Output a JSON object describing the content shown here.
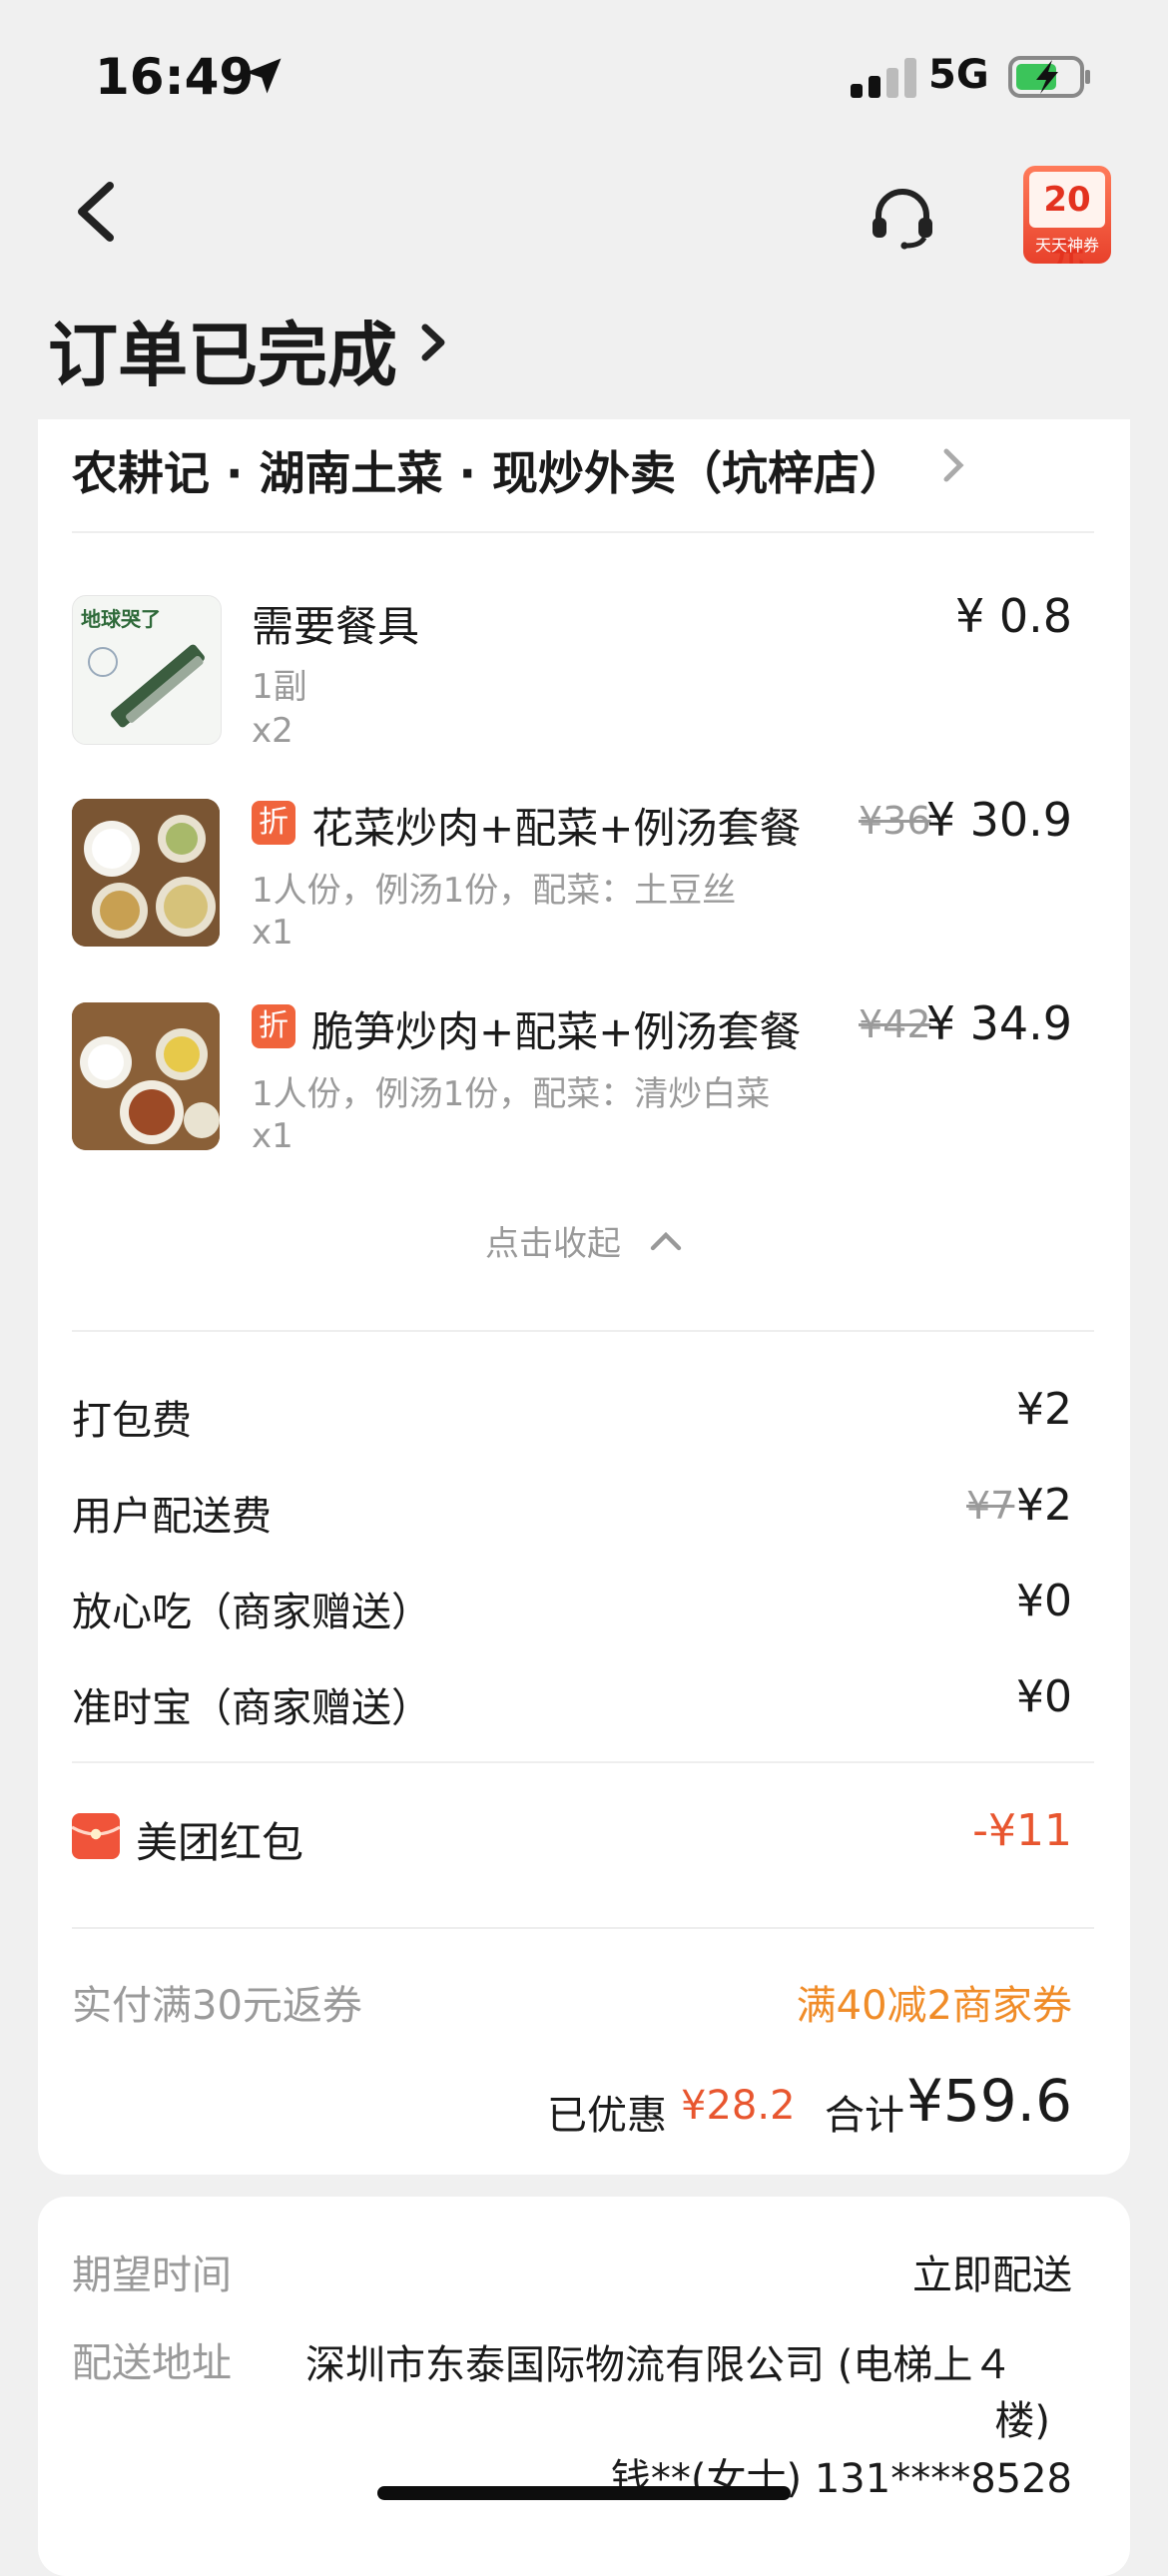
{
  "status_bar": {
    "time": "16:49",
    "network": "5G"
  },
  "header": {
    "promo_amount": "20元",
    "promo_sub": "天天神券",
    "title": "订单已完成"
  },
  "store": {
    "name": "农耕记 · 湖南土菜 · 现炒外卖（坑梓店）"
  },
  "items": [
    {
      "name": "需要餐具",
      "spec": "1副",
      "qty": "x2",
      "price": "¥ 0.8",
      "thumb_text": "地球哭了"
    },
    {
      "name": "花菜炒肉+配菜+例汤套餐",
      "spec": "1人份，例汤1份，配菜：土豆丝",
      "qty": "x1",
      "orig": "¥36",
      "price": "¥ 30.9",
      "badge": "折"
    },
    {
      "name": "脆笋炒肉+配菜+例汤套餐",
      "spec": "1人份，例汤1份，配菜：清炒白菜",
      "qty": "x1",
      "orig": "¥42",
      "price": "¥ 34.9",
      "badge": "折"
    }
  ],
  "collapse_label": "点击收起",
  "fees": [
    {
      "label": "打包费",
      "value": "¥2"
    },
    {
      "label": "用户配送费",
      "orig": "¥7",
      "value": "¥2"
    },
    {
      "label": "放心吃（商家赠送）",
      "value": "¥0"
    },
    {
      "label": "准时宝（商家赠送）",
      "value": "¥0"
    }
  ],
  "red_packet": {
    "label": "美团红包",
    "value": "-¥11"
  },
  "coupon": {
    "left": "实付满30元返券",
    "right": "满40减2商家券"
  },
  "summary": {
    "saved_label": "已优惠",
    "saved_value": "¥28.2",
    "total_label": "合计",
    "total_value": "¥59.6"
  },
  "delivery": {
    "time_label": "期望时间",
    "time_value": "立即配送",
    "address_label": "配送地址",
    "address_line1": "深圳市东泰国际物流有限公司 (电梯上４",
    "address_line2": "楼)",
    "contact": "钱**(女士) 131****8528"
  },
  "colors": {
    "accent_red": "#e8562f",
    "coupon_orange": "#f08c28",
    "badge": "#f0643c"
  }
}
